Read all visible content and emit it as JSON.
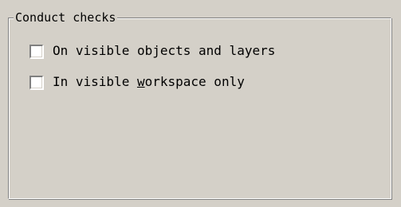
{
  "groupbox": {
    "title": "Conduct checks"
  },
  "options": [
    {
      "label": "On visible objects and layers",
      "checked": false
    },
    {
      "label_before": "In visible ",
      "label_accel": "w",
      "label_after": "orkspace only",
      "checked": false
    }
  ]
}
